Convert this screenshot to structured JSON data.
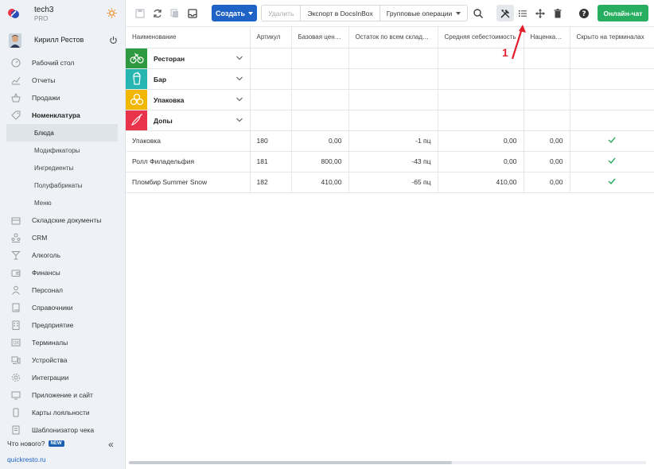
{
  "brand": {
    "name": "tech3",
    "plan": "PRO"
  },
  "user": {
    "name": "Кирилл Рестов"
  },
  "nav": {
    "items": [
      {
        "label": "Рабочий стол",
        "icon": "dashboard-icon"
      },
      {
        "label": "Отчеты",
        "icon": "chart-icon"
      },
      {
        "label": "Продажи",
        "icon": "basket-icon"
      },
      {
        "label": "Номенклатура",
        "icon": "tag-icon"
      }
    ],
    "sub": [
      {
        "label": "Блюда"
      },
      {
        "label": "Модификаторы"
      },
      {
        "label": "Ингредиенты"
      },
      {
        "label": "Полуфабрикаты"
      },
      {
        "label": "Меню"
      }
    ],
    "items2": [
      {
        "label": "Складские документы",
        "icon": "warehouse-icon"
      },
      {
        "label": "CRM",
        "icon": "people-icon"
      },
      {
        "label": "Алкоголь",
        "icon": "glass-icon"
      },
      {
        "label": "Финансы",
        "icon": "wallet-icon"
      },
      {
        "label": "Персонал",
        "icon": "person-icon"
      },
      {
        "label": "Справочники",
        "icon": "book-icon"
      },
      {
        "label": "Предприятие",
        "icon": "building-icon"
      },
      {
        "label": "Терминалы",
        "icon": "terminal-icon"
      },
      {
        "label": "Устройства",
        "icon": "devices-icon"
      },
      {
        "label": "Интеграции",
        "icon": "gear-icon"
      },
      {
        "label": "Приложение и сайт",
        "icon": "monitor-icon"
      },
      {
        "label": "Карты лояльности",
        "icon": "card-icon"
      },
      {
        "label": "Шаблонизатор чека",
        "icon": "receipt-icon"
      }
    ],
    "whats_new": "Что нового?",
    "new_badge": "NEW",
    "site": "quickresto.ru"
  },
  "toolbar": {
    "create": "Создать",
    "delete": "Удалить",
    "export": "Экспорт в DocsInBox",
    "group_ops": "Групповые операции",
    "chat": "Онлайн-чат"
  },
  "table": {
    "columns": [
      "Наименование",
      "Артикул",
      "Базовая цена, ₽",
      "Остаток по всем складам,...",
      "Средняя себестоимость",
      "Наценка, %",
      "Скрыто на терминалах"
    ],
    "groups": [
      {
        "label": "Ресторан",
        "color": "#2e9a3f",
        "icon": "bicycle-icon"
      },
      {
        "label": "Бар",
        "color": "#26b5b0",
        "icon": "cup-icon"
      },
      {
        "label": "Упаковка",
        "color": "#f2b705",
        "icon": "boxes-icon"
      },
      {
        "label": "Допы",
        "color": "#e8334a",
        "icon": "chili-icon"
      }
    ],
    "rows": [
      {
        "name": "Упаковка",
        "sku": "180",
        "price": "0,00",
        "stock": "-1 пц",
        "cost": "0,00",
        "markup": "0,00"
      },
      {
        "name": "Ролл Филадельфия",
        "sku": "181",
        "price": "800,00",
        "stock": "-43 пц",
        "cost": "0,00",
        "markup": "0,00"
      },
      {
        "name": "Пломбир Summer Snow",
        "sku": "182",
        "price": "410,00",
        "stock": "-65 пц",
        "cost": "410,00",
        "markup": "0,00"
      }
    ]
  },
  "annotation": {
    "label": "1"
  },
  "colors": {
    "accent": "#1f63c6",
    "chat": "#27ae60",
    "check": "#27ae60",
    "annotation": "#e0202a"
  }
}
